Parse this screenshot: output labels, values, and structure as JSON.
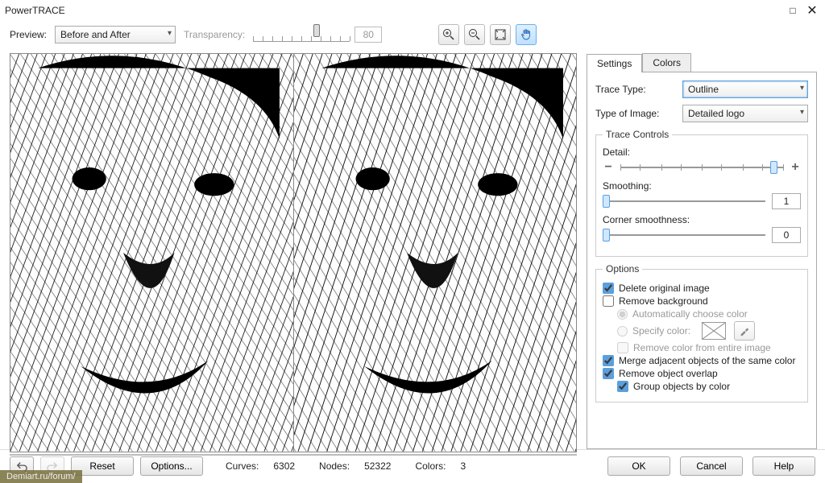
{
  "window": {
    "title": "PowerTRACE"
  },
  "toolbar": {
    "preview_label": "Preview:",
    "preview_value": "Before and After",
    "transparency_label": "Transparency:",
    "transparency_value": "80"
  },
  "tabs": {
    "settings": "Settings",
    "colors": "Colors"
  },
  "settings": {
    "trace_type_label": "Trace Type:",
    "trace_type_value": "Outline",
    "image_type_label": "Type of Image:",
    "image_type_value": "Detailed logo",
    "trace_controls_legend": "Trace Controls",
    "detail_label": "Detail:",
    "smoothing_label": "Smoothing:",
    "smoothing_value": "1",
    "corner_label": "Corner smoothness:",
    "corner_value": "0",
    "options_legend": "Options",
    "delete_original": "Delete original image",
    "remove_bg": "Remove background",
    "auto_color": "Automatically choose color",
    "specify_color": "Specify color:",
    "remove_entire": "Remove color from entire image",
    "merge_adjacent": "Merge adjacent objects of the same color",
    "remove_overlap": "Remove object overlap",
    "group_by_color": "Group objects by color"
  },
  "footer": {
    "reset": "Reset",
    "options": "Options...",
    "curves_label": "Curves:",
    "curves_value": "6302",
    "nodes_label": "Nodes:",
    "nodes_value": "52322",
    "colors_label": "Colors:",
    "colors_value": "3",
    "ok": "OK",
    "cancel": "Cancel",
    "help": "Help"
  },
  "watermark": "Demiart.ru/forum/"
}
